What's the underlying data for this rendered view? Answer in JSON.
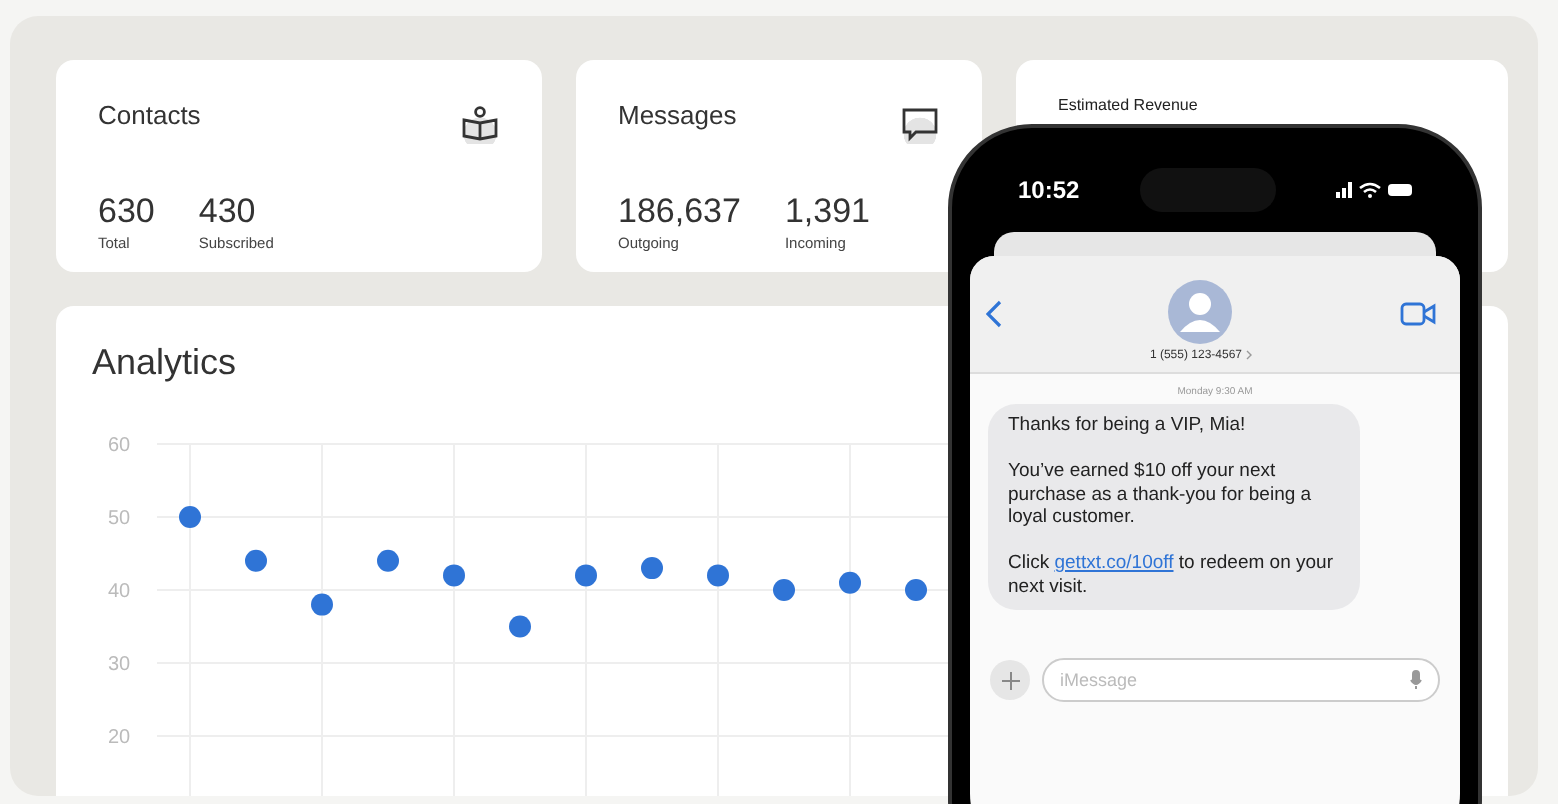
{
  "cards": [
    {
      "kind": "stat",
      "title": "Contacts",
      "stats": [
        {
          "value": "630",
          "label": "Total"
        },
        {
          "value": "430",
          "label": "Subscribed"
        }
      ]
    },
    {
      "kind": "stat",
      "title": "Messages",
      "stats": [
        {
          "value": "186,637",
          "label": "Outgoing"
        },
        {
          "value": "1,391",
          "label": "Incoming"
        }
      ]
    },
    {
      "kind": "compact",
      "title": "Estimated Revenue"
    }
  ],
  "analytics": {
    "title": "Analytics",
    "chart_data": {
      "type": "scatter",
      "categories": [
        null,
        null,
        null,
        null,
        null,
        null,
        null,
        null,
        null,
        null,
        null,
        null
      ],
      "values": [
        50,
        44,
        38,
        44,
        42,
        35,
        42,
        43,
        42,
        40,
        41,
        40
      ],
      "ylim": [
        10,
        60
      ],
      "yticks": [
        20,
        30,
        40,
        50,
        60
      ],
      "grid": true
    }
  },
  "phone": {
    "time": "10:52",
    "contact": "1 (555) 123-4567",
    "timestamp": "Monday 9:30 AM",
    "message": {
      "paragraphs": [
        "Thanks for being a VIP, Mia!",
        "You’ve earned $10 off your next purchase as a thank-you for being a loyal customer."
      ],
      "link_before": "Click ",
      "link": "gettxt.co/10off",
      "link_after": " to redeem on your next visit."
    },
    "input": {
      "placeholder": "iMessage"
    }
  }
}
